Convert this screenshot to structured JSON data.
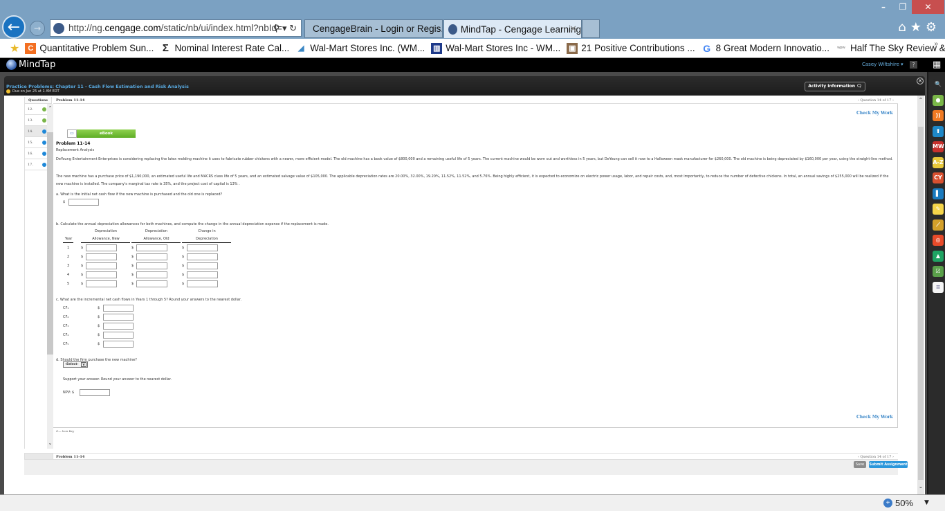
{
  "browser": {
    "window_controls": {
      "minimize": "–",
      "restore": "❐",
      "close": "✕"
    },
    "address": {
      "prefix": "http://ng.",
      "domain": "cengage.com",
      "suffix": "/static/nb/ui/index.html?nbId=",
      "tools": "⚲ ▾ ↻"
    },
    "tabs": [
      {
        "label": "CengageBrain - Login or Regis...",
        "icon": "ie-e-icon",
        "active": false
      },
      {
        "label": "MindTap - Cengage Learning",
        "icon": "mindtap-globe-icon",
        "active": true
      }
    ],
    "tab_close": "✕",
    "toolbar_icons": {
      "home": "⌂",
      "favorites": "★",
      "settings": "⚙"
    },
    "favorites": [
      {
        "label": "Quantitative Problem Sun...",
        "icon": "C",
        "color": "#f36f21"
      },
      {
        "label": "Nominal Interest Rate Cal...",
        "icon": "Σ",
        "color": "#222222"
      },
      {
        "label": "Wal-Mart Stores Inc. (WM...",
        "icon": "◢",
        "color": "#3a87c4"
      },
      {
        "label": "Wal-Mart Stores Inc - WM...",
        "icon": "▥",
        "color": "#1e3a8a"
      },
      {
        "label": "21 Positive Contributions ...",
        "icon": "▣",
        "color": "#8a6a4a"
      },
      {
        "label": "8 Great Modern Innovatio...",
        "icon": "G",
        "color": "#4285f4"
      },
      {
        "label": "Half The Sky  Review & N...",
        "icon": "ʷᵖʷ",
        "color": "#999999"
      }
    ],
    "favorites_more": "»",
    "zoom_level": "50%",
    "zoom_dropdown": "▼"
  },
  "mindtap": {
    "logo": "MindTap",
    "user": "Casey Wiltshire ▾",
    "help": "?",
    "apps_grid": "▦",
    "activity": {
      "title": "Practice Problems: Chapter 11 - Cash Flow Estimation and Risk Analysis",
      "due": "Due on Jun 25 at 1 AM EDT",
      "info_button": "Activity Information 🗨",
      "close": "✕"
    },
    "dock_icons": [
      {
        "name": "search-app-icon",
        "glyph": "🔍",
        "color": "#2b2b2b"
      },
      {
        "name": "progress-app-icon",
        "glyph": "●",
        "color": "#7ab648"
      },
      {
        "name": "rss-app-icon",
        "glyph": "))",
        "color": "#f07a23"
      },
      {
        "name": "upload-app-icon",
        "glyph": "⬆",
        "color": "#1e88c8"
      },
      {
        "name": "merriam-webster-app-icon",
        "glyph": "MW",
        "color": "#c8302c"
      },
      {
        "name": "a-z-glossary-app-icon",
        "glyph": "A-Z",
        "color": "#e8c83a"
      },
      {
        "name": "cy-app-icon",
        "glyph": "CY",
        "color": "#d9502f"
      },
      {
        "name": "book-app-icon",
        "glyph": "▌",
        "color": "#1a7bbf"
      },
      {
        "name": "notes-app-icon",
        "glyph": "✎",
        "color": "#f5d54a"
      },
      {
        "name": "graph-app-icon",
        "glyph": "⟋",
        "color": "#d4a02a"
      },
      {
        "name": "cengage-app-icon",
        "glyph": "◎",
        "color": "#e84b2a"
      },
      {
        "name": "google-drive-app-icon",
        "glyph": "▲",
        "color": "#1fa463"
      },
      {
        "name": "checklist-app-icon",
        "glyph": "☑",
        "color": "#5aa04a"
      },
      {
        "name": "notepad-app-icon",
        "glyph": "≡",
        "color": "#f5f5f5"
      }
    ]
  },
  "questions": {
    "header": "Questions",
    "items": [
      {
        "number": "12.",
        "status_color": "#7ab648",
        "active": false
      },
      {
        "number": "13.",
        "status_color": "#7ab648",
        "active": false
      },
      {
        "number": "14.",
        "status_color": "#1e88d8",
        "active": true
      },
      {
        "number": "15.",
        "status_color": "#1e88d8",
        "active": false
      },
      {
        "number": "16.",
        "status_color": "#1e88d8",
        "active": false
      },
      {
        "number": "17.",
        "status_color": "#1e88d8",
        "active": false
      }
    ]
  },
  "problem": {
    "header": "Problem 11-14",
    "nav": "‹ Question 14 of 17 ›",
    "check_my_work": "Check My Work",
    "ebook": "eBook",
    "ebook_icon": "▭",
    "title": "Problem 11-14",
    "subtitle": "Replacement Analysis",
    "paragraph1": "DeYoung Entertainment Enterprises is considering replacing the latex molding machine it uses to fabricate rubber chickens with a newer, more efficient model. The old machine has a book value of $800,000 and a remaining useful life of 5 years. The current machine would be worn out and worthless in 5 years, but DeYoung can sell it now to a Halloween mask manufacturer for $260,000. The old machine is being depreciated by $160,000 per year, using the straight-line method.",
    "paragraph2": "The new machine has a purchase price of $1,190,000, an estimated useful life and MACRS class life of 5 years, and an estimated salvage value of $105,000. The applicable depreciation rates are 20.00%, 32.00%, 19.20%, 11.52%, 11.52%, and 5.76%. Being highly efficient, it is expected to economize on electric power usage, labor, and repair costs, and, most importantly, to reduce the number of defective chickens. In total, an annual savings of $255,000 will be realized if the new machine is installed. The company's marginal tax rate is 35%, and the project cost of capital is 13% .",
    "part_a": {
      "question": "a.  What is the initial net cash flow if the new machine is purchased and the old one is replaced?",
      "currency": "$",
      "value": ""
    },
    "part_b": {
      "question": "b.  Calculate the annual depreciation allowances for both machines, and compute the change in the annual depreciation expense if the replacement is made.",
      "columns": [
        {
          "line1": "",
          "line2": "Year"
        },
        {
          "line1": "Depreciation",
          "line2": "Allowance, New"
        },
        {
          "line1": "Depreciation",
          "line2": "Allowance, Old"
        },
        {
          "line1": "Change in",
          "line2": "Depreciation"
        }
      ],
      "currency": "$",
      "rows": [
        {
          "year": "1",
          "new": "",
          "old": "",
          "change": ""
        },
        {
          "year": "2",
          "new": "",
          "old": "",
          "change": ""
        },
        {
          "year": "3",
          "new": "",
          "old": "",
          "change": ""
        },
        {
          "year": "4",
          "new": "",
          "old": "",
          "change": ""
        },
        {
          "year": "5",
          "new": "",
          "old": "",
          "change": ""
        }
      ]
    },
    "part_c": {
      "question": "c.  What are the incremental net cash flows in Years 1 through 5? Round your answers to the nearest dollar.",
      "currency": "$",
      "rows": [
        {
          "label": "CF₁",
          "value": ""
        },
        {
          "label": "CF₂",
          "value": ""
        },
        {
          "label": "CF₃",
          "value": ""
        },
        {
          "label": "CF₄",
          "value": ""
        },
        {
          "label": "CF₅",
          "value": ""
        }
      ]
    },
    "part_d": {
      "question": "d.  Should the firm purchase the new machine?",
      "select": "-Select-",
      "select_arrow": "v",
      "support": "Support your answer. Round your answer to the nearest dollar.",
      "npv_label": "NPV: $",
      "npv_value": ""
    },
    "icon_key": "O— Icon Key",
    "footer_header": "Problem 11-14",
    "footer_nav": "‹ Question 14 of 17 ›",
    "save": "Save",
    "submit": "Submit Assignment"
  }
}
